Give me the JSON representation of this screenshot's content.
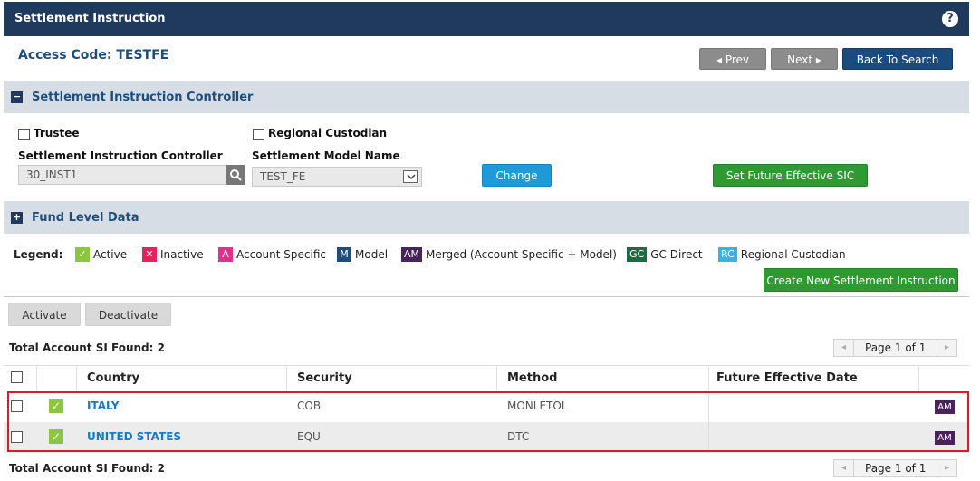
{
  "header": {
    "title": "Settlement Instruction",
    "help": "?"
  },
  "access_code": "Access Code: TESTFE",
  "nav": {
    "prev": "◂ Prev",
    "next": "Next ▸",
    "back": "Back To Search"
  },
  "section1": {
    "toggle": "−",
    "label": "Settlement Instruction Controller"
  },
  "controller": {
    "trustee_label": "Trustee",
    "regional_label": "Regional Custodian",
    "sic_label": "Settlement Instruction Controller",
    "sic_value": "30_INST1",
    "model_label": "Settlement Model Name",
    "model_value": "TEST_FE",
    "change": "Change",
    "set_future": "Set Future Effective SIC"
  },
  "section2": {
    "toggle": "+",
    "label": "Fund Level Data"
  },
  "legend": {
    "title": "Legend:",
    "items": [
      {
        "badge": "✓",
        "text": "Active",
        "color": "#8cc63f"
      },
      {
        "badge": "✕",
        "text": "Inactive",
        "color": "#e0245e"
      },
      {
        "badge": "A",
        "text": "Account Specific",
        "color": "#e62e8b"
      },
      {
        "badge": "M",
        "text": "Model",
        "color": "#1f4e79"
      },
      {
        "badge": "AM",
        "text": "Merged (Account Specific + Model)",
        "color": "#4a235a"
      },
      {
        "badge": "GC",
        "text": "GC Direct",
        "color": "#1d6b40"
      },
      {
        "badge": "RC",
        "text": "Regional Custodian",
        "color": "#35b4e6"
      }
    ]
  },
  "create_new": "Create New Settlement Instruction",
  "actions": {
    "activate": "Activate",
    "deactivate": "Deactivate"
  },
  "total_top": "Total Account SI Found: 2",
  "total_bottom": "Total Account SI Found: 2",
  "pager": {
    "prev": "◂",
    "text": "Page 1 of 1",
    "next": "▸"
  },
  "table": {
    "columns": [
      "Country",
      "Security",
      "Method",
      "Future Effective Date"
    ],
    "rows": [
      {
        "status": "✓",
        "country": "ITALY",
        "security": "COB",
        "method": "MONLETOL",
        "future_date": "",
        "type": "AM"
      },
      {
        "status": "✓",
        "country": "UNITED STATES",
        "security": "EQU",
        "method": "DTC",
        "future_date": "",
        "type": "AM"
      }
    ]
  }
}
